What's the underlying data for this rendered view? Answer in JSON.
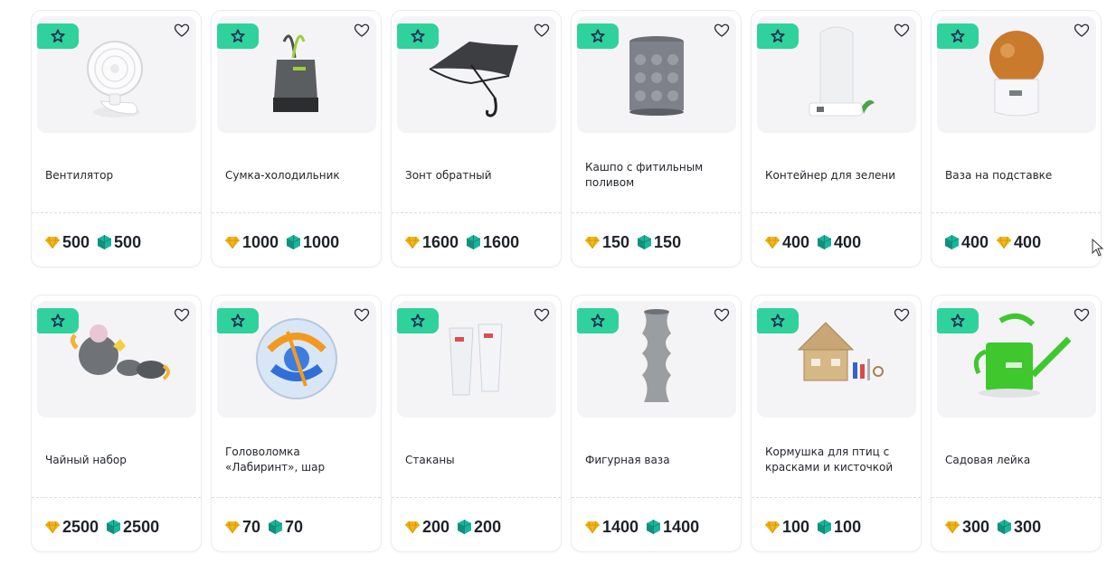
{
  "colors": {
    "badge": "#2fd29b",
    "badge_star": "#1d2b52",
    "diamond": "#f3b617",
    "gem": "#19b59b"
  },
  "products": [
    {
      "name": "Вентилятор",
      "icon": "fan-image",
      "prices": [
        {
          "currency": "diamond",
          "value": "500"
        },
        {
          "currency": "gem",
          "value": "500"
        }
      ]
    },
    {
      "name": "Сумка-холодильник",
      "icon": "cooler-bag-image",
      "prices": [
        {
          "currency": "diamond",
          "value": "1000"
        },
        {
          "currency": "gem",
          "value": "1000"
        }
      ]
    },
    {
      "name": "Зонт обратный",
      "icon": "umbrella-image",
      "prices": [
        {
          "currency": "diamond",
          "value": "1600"
        },
        {
          "currency": "gem",
          "value": "1600"
        }
      ]
    },
    {
      "name": "Кашпо с фитильным поливом",
      "icon": "planter-image",
      "prices": [
        {
          "currency": "diamond",
          "value": "150"
        },
        {
          "currency": "gem",
          "value": "150"
        }
      ]
    },
    {
      "name": "Контейнер для зелени",
      "icon": "greens-container-image",
      "prices": [
        {
          "currency": "diamond",
          "value": "400"
        },
        {
          "currency": "gem",
          "value": "400"
        }
      ]
    },
    {
      "name": "Ваза на подставке",
      "icon": "vase-stand-image",
      "prices": [
        {
          "currency": "gem",
          "value": "400"
        },
        {
          "currency": "diamond",
          "value": "400"
        }
      ]
    },
    {
      "name": "Чайный набор",
      "icon": "tea-set-image",
      "prices": [
        {
          "currency": "diamond",
          "value": "2500"
        },
        {
          "currency": "gem",
          "value": "2500"
        }
      ]
    },
    {
      "name": "Головоломка «Лабиринт», шар",
      "icon": "maze-ball-image",
      "prices": [
        {
          "currency": "diamond",
          "value": "70"
        },
        {
          "currency": "gem",
          "value": "70"
        }
      ]
    },
    {
      "name": "Стаканы",
      "icon": "glasses-image",
      "prices": [
        {
          "currency": "diamond",
          "value": "200"
        },
        {
          "currency": "gem",
          "value": "200"
        }
      ]
    },
    {
      "name": "Фигурная ваза",
      "icon": "figured-vase-image",
      "prices": [
        {
          "currency": "diamond",
          "value": "1400"
        },
        {
          "currency": "gem",
          "value": "1400"
        }
      ]
    },
    {
      "name": "Кормушка для птиц с красками и кисточкой",
      "icon": "bird-feeder-image",
      "prices": [
        {
          "currency": "diamond",
          "value": "100"
        },
        {
          "currency": "gem",
          "value": "100"
        }
      ]
    },
    {
      "name": "Садовая лейка",
      "icon": "watering-can-image",
      "prices": [
        {
          "currency": "diamond",
          "value": "300"
        },
        {
          "currency": "gem",
          "value": "300"
        }
      ]
    }
  ]
}
